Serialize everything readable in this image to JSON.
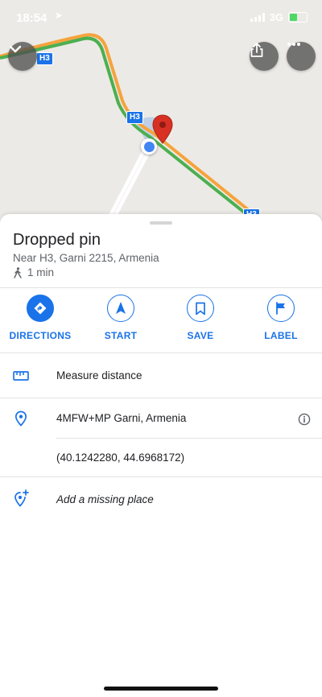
{
  "status_bar": {
    "time": "18:54",
    "network": "3G"
  },
  "map": {
    "road_labels": [
      "H3",
      "H3",
      "H3"
    ]
  },
  "place": {
    "title": "Dropped pin",
    "subtitle": "Near H3, Garni 2215, Armenia",
    "walk_time": "1 min"
  },
  "actions": [
    {
      "label": "DIRECTIONS",
      "icon": "directions-icon"
    },
    {
      "label": "START",
      "icon": "navigation-arrow-icon"
    },
    {
      "label": "SAVE",
      "icon": "bookmark-icon"
    },
    {
      "label": "LABEL",
      "icon": "flag-icon"
    }
  ],
  "rows": {
    "measure": "Measure distance",
    "plus_code": "4MFW+MP Garni, Armenia",
    "coordinates": "(40.1242280, 44.6968172)",
    "add_place": "Add a missing place"
  },
  "colors": {
    "accent": "#1a73e8",
    "pin": "#d93025",
    "traffic_green": "#4caf50",
    "traffic_orange": "#f6a33d"
  }
}
